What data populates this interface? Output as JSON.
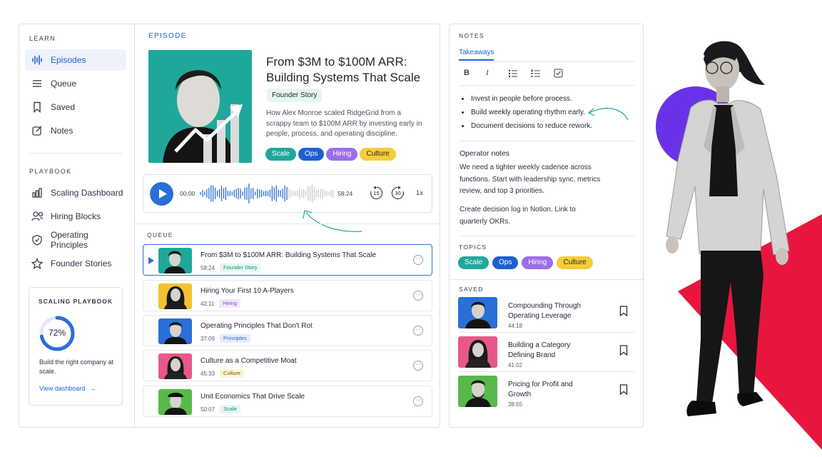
{
  "sidebar": {
    "learn_label": "LEARN",
    "learn_items": [
      {
        "label": "Episodes",
        "icon": "waveform-icon",
        "active": true
      },
      {
        "label": "Queue",
        "icon": "list-icon"
      },
      {
        "label": "Saved",
        "icon": "bookmark-icon"
      },
      {
        "label": "Notes",
        "icon": "edit-icon"
      }
    ],
    "playbook_label": "PLAYBOOK",
    "playbook_items": [
      {
        "label": "Scaling Dashboard",
        "icon": "bar-chart-icon"
      },
      {
        "label": "Hiring Blocks",
        "icon": "people-icon"
      },
      {
        "label": "Operating Principles",
        "icon": "shield-icon"
      },
      {
        "label": "Founder Stories",
        "icon": "star-icon"
      }
    ],
    "card": {
      "title": "SCALING PLAYBOOK",
      "percent_label": "72%",
      "percent": 0.72,
      "desc": "Build the right company at scale.",
      "link": "View dashboard",
      "arrow": "→"
    }
  },
  "episode": {
    "section_label": "EPISODE",
    "title": "From $3M to $100M ARR: Building Systems That Scale",
    "chip": "Founder Story",
    "description": "How Alex Monroe scaled RidgeGrid from a scrappy team to $100M ARR by investing early in people, process, and operating discipline.",
    "tags": [
      {
        "label": "Scale",
        "bg": "#1fa89a",
        "fg": "#ffffff"
      },
      {
        "label": "Ops",
        "bg": "#1e5fd0",
        "fg": "#ffffff"
      },
      {
        "label": "Hiring",
        "bg": "#9b6ee8",
        "fg": "#ffffff"
      },
      {
        "label": "Culture",
        "bg": "#f5cc3a",
        "fg": "#2a2a2a"
      }
    ]
  },
  "player": {
    "current": "00:00",
    "duration": "58:24",
    "skip_back": "15",
    "skip_forward": "30",
    "speed": "1x"
  },
  "queue": {
    "label": "QUEUE",
    "items": [
      {
        "title": "From $3M to $100M ARR: Building Systems That Scale",
        "time": "58:24",
        "tag": "Founder Story",
        "tag_bg": "#e6f6f2",
        "tag_fg": "#168a75",
        "thumb_bg": "#1fa89a",
        "active": true
      },
      {
        "title": "Hiring Your First 10 A-Players",
        "time": "42:11",
        "tag": "Hiring",
        "tag_bg": "#efe7fc",
        "tag_fg": "#7a4fd6",
        "thumb_bg": "#f2c230",
        "active": false
      },
      {
        "title": "Operating Principles That Don't Rot",
        "time": "37:09",
        "tag": "Principles",
        "tag_bg": "#e5eefc",
        "tag_fg": "#2a62c9",
        "thumb_bg": "#2a6fd6",
        "active": false
      },
      {
        "title": "Culture as a Competitive Moat",
        "time": "45:33",
        "tag": "Culture",
        "tag_bg": "#fdf4d4",
        "tag_fg": "#6e5a10",
        "thumb_bg": "#e8578a",
        "active": false
      },
      {
        "title": "Unit Economics That Drive Scale",
        "time": "50:07",
        "tag": "Scale",
        "tag_bg": "#e6f6f2",
        "tag_fg": "#168a75",
        "thumb_bg": "#58b94a",
        "active": false
      }
    ],
    "more_glyph": "···"
  },
  "notes": {
    "label": "NOTES",
    "tab": "Takeaways",
    "toolbar": {
      "bold": "B",
      "italic": "I"
    },
    "bullets": [
      "Invest in people before process.",
      "Build weekly operating rhythm early.",
      "Document decisions to reduce rework."
    ],
    "operator_heading": "Operator notes",
    "operator_p1": "We need a tighter weekly cadence across functions. Start with leadership sync, metrics review, and top 3 priorities.",
    "operator_p2": "Create decision log in Notion. Link to quarterly OKRs."
  },
  "topics": {
    "label": "TOPICS",
    "items": [
      {
        "label": "Scale",
        "bg": "#1fa89a",
        "fg": "#ffffff"
      },
      {
        "label": "Ops",
        "bg": "#1e5fd0",
        "fg": "#ffffff"
      },
      {
        "label": "Hiring",
        "bg": "#9b6ee8",
        "fg": "#ffffff"
      },
      {
        "label": "Culture",
        "bg": "#f5cc3a",
        "fg": "#2a2a2a"
      }
    ]
  },
  "saved": {
    "label": "SAVED",
    "items": [
      {
        "title": "Compounding Through Operating Leverage",
        "time": "44:18",
        "thumb_bg": "#2a6fd6"
      },
      {
        "title": "Building a Category Defining Brand",
        "time": "41:02",
        "thumb_bg": "#e8578a"
      },
      {
        "title": "Pricing for Profit and Growth",
        "time": "38:55",
        "thumb_bg": "#58b94a"
      }
    ]
  },
  "colors": {
    "accent": "#1f63c8",
    "purple": "#6a32e8",
    "red": "#e8163e",
    "teal": "#1fa89a"
  }
}
